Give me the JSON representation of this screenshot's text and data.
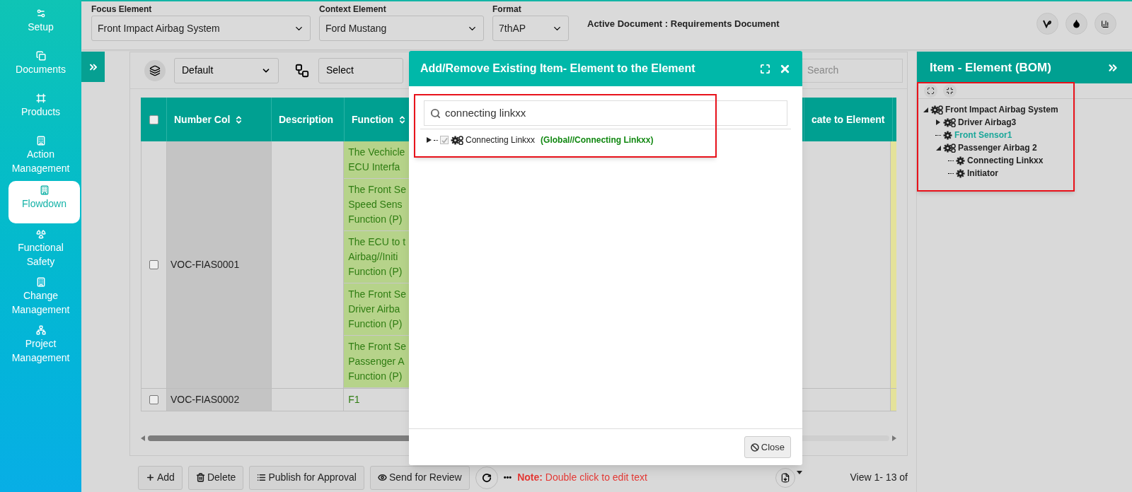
{
  "sidebar": {
    "items": [
      {
        "label": "Setup",
        "selected": false
      },
      {
        "label": "Documents",
        "selected": false
      },
      {
        "label": "Products",
        "selected": false
      },
      {
        "label": "Action Management",
        "selected": false
      },
      {
        "label": "Flowdown",
        "selected": true
      },
      {
        "label": "Functional Safety",
        "selected": false
      },
      {
        "label": "Change Management",
        "selected": false
      },
      {
        "label": "Project Management",
        "selected": false
      }
    ]
  },
  "top_bar": {
    "fields": [
      {
        "label": "Focus Element",
        "value": "Front Impact Airbag System"
      },
      {
        "label": "Context Element",
        "value": "Ford Mustang"
      },
      {
        "label": "Format",
        "value": "7thAP"
      }
    ],
    "active_document": "Active Document : Requirements Document"
  },
  "toolbar": {
    "view_select": "Default",
    "column_select": "Select",
    "search_placeholder": "Search"
  },
  "table": {
    "all_checked": false,
    "columns": [
      "Number Col",
      "Description",
      "Function",
      "cate to Element"
    ],
    "rows": [
      {
        "number": "VOC-FIAS0001",
        "checked": false,
        "functions": [
          [
            "The Vechicle",
            "ECU Interfa"
          ],
          [
            "The Front Se",
            "Speed Sens",
            "Function (P)"
          ],
          [
            "The ECU to t",
            "Airbag//Initi",
            "Function (P)"
          ],
          [
            "The Front Se",
            "Driver Airba",
            "Function (P)"
          ],
          [
            "The Front Se",
            "Passenger A",
            "Function (P)"
          ]
        ]
      },
      {
        "number": "VOC-FIAS0002",
        "checked": false,
        "functions": [
          [
            "F1"
          ]
        ]
      }
    ]
  },
  "footer": {
    "buttons": [
      {
        "label": "Add"
      },
      {
        "label": "Delete"
      },
      {
        "label": "Publish for Approval"
      },
      {
        "label": "Send for Review"
      }
    ],
    "more": "•••",
    "note": "**Note:** Double click to edit text",
    "pager": "View 1- 13 of"
  },
  "modal": {
    "title": "Add/Remove Existing Item- Element to the Element",
    "search_value": "connecting linkxx",
    "items": [
      {
        "label": "Connecting Linkxx",
        "path": "(Global//Connecting Linkxx)",
        "checked": true,
        "expanded": false
      }
    ],
    "close": "Close"
  },
  "bom_panel": {
    "title": "Item - Element (BOM)",
    "tree": [
      {
        "label": "Front Impact Airbag System",
        "kind": "group",
        "expanded": true,
        "selected": false,
        "children": [
          {
            "label": "Driver Airbag3",
            "kind": "group",
            "expanded": false,
            "selected": false
          },
          {
            "label": "Front Sensor1",
            "kind": "leaf",
            "selected": true
          },
          {
            "label": "Passenger Airbag 2",
            "kind": "group",
            "expanded": true,
            "selected": false,
            "children": [
              {
                "label": "Connecting Linkxx",
                "kind": "leaf",
                "selected": false
              },
              {
                "label": "Initiator",
                "kind": "leaf",
                "selected": false
              }
            ]
          }
        ]
      }
    ]
  }
}
